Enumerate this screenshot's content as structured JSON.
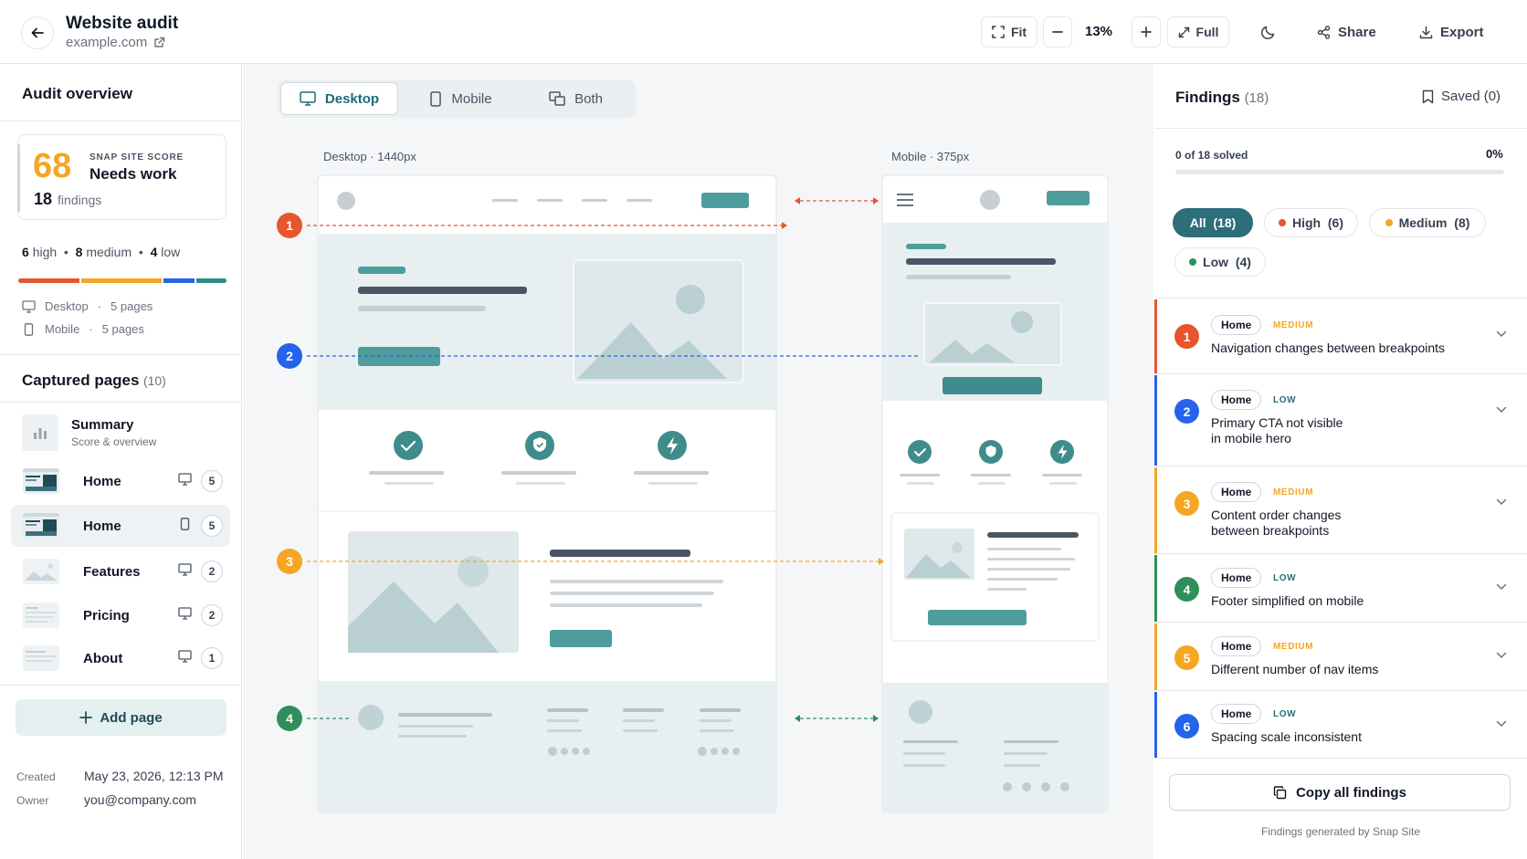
{
  "header": {
    "title": "Website audit",
    "site": "example.com",
    "fit_label": "Fit",
    "zoom": "13%",
    "full_label": "Full",
    "share_label": "Share",
    "export_label": "Export"
  },
  "overview": {
    "title": "Audit overview",
    "score": "68",
    "score_label": "SNAP SITE SCORE",
    "score_state": "Needs work",
    "findings_count": "18",
    "findings_word": "findings",
    "high_count": "6",
    "high_label": "high",
    "medium_count": "8",
    "medium_label": "medium",
    "low_count": "4",
    "low_label": "low",
    "desktop_label": "Desktop",
    "desktop_pages": "5 pages",
    "mobile_label": "Mobile",
    "mobile_pages": "5 pages"
  },
  "captured": {
    "title": "Captured pages",
    "count": "(10)",
    "summary_title": "Summary",
    "summary_sub": "Score & overview",
    "pages": [
      {
        "name": "Home",
        "device": "desktop",
        "count": "5"
      },
      {
        "name": "Home",
        "device": "mobile",
        "count": "5"
      },
      {
        "name": "Features",
        "device": "desktop",
        "count": "2"
      },
      {
        "name": "Pricing",
        "device": "desktop",
        "count": "2"
      },
      {
        "name": "About",
        "device": "desktop",
        "count": "1"
      }
    ],
    "add_label": "Add page",
    "created_label": "Created",
    "created_value": "May 23, 2026, 12:13 PM",
    "owner_label": "Owner",
    "owner_value": "you@company.com"
  },
  "canvas": {
    "tab_desktop": "Desktop",
    "tab_mobile": "Mobile",
    "tab_both": "Both",
    "desktop_viewport": "Desktop · 1440px",
    "mobile_viewport": "Mobile · 375px",
    "markers": [
      "1",
      "2",
      "3",
      "4"
    ]
  },
  "findings": {
    "title": "Findings",
    "count": "(18)",
    "saved_label": "Saved (0)",
    "solved_label": "0 of 18 solved",
    "percent": "0%",
    "progress": 0,
    "filters": {
      "all": "All  (18)",
      "high": "High  (6)",
      "medium": "Medium  (8)",
      "low": "Low  (4)"
    },
    "items": [
      {
        "num": "1",
        "page": "Home",
        "level": "MEDIUM",
        "text": "Navigation changes between breakpoints"
      },
      {
        "num": "2",
        "page": "Home",
        "level": "LOW",
        "text_1": "Primary CTA not visible",
        "text_2": "in mobile hero"
      },
      {
        "num": "3",
        "page": "Home",
        "level": "MEDIUM",
        "text_1": "Content order changes",
        "text_2": "between breakpoints"
      },
      {
        "num": "4",
        "page": "Home",
        "level": "LOW",
        "text": "Footer simplified on mobile"
      },
      {
        "num": "5",
        "page": "Home",
        "level": "MEDIUM",
        "text": "Different number of nav items"
      },
      {
        "num": "6",
        "page": "Home",
        "level": "LOW",
        "text": "Spacing scale inconsistent"
      }
    ],
    "copy_label": "Copy all findings",
    "footnote": "Findings generated by Snap Site"
  },
  "colors": {
    "accent": "#2c6e7a",
    "high": "#e8542c",
    "medium": "#f5a623",
    "low": "#2f8f5b",
    "blue": "#2563eb"
  }
}
